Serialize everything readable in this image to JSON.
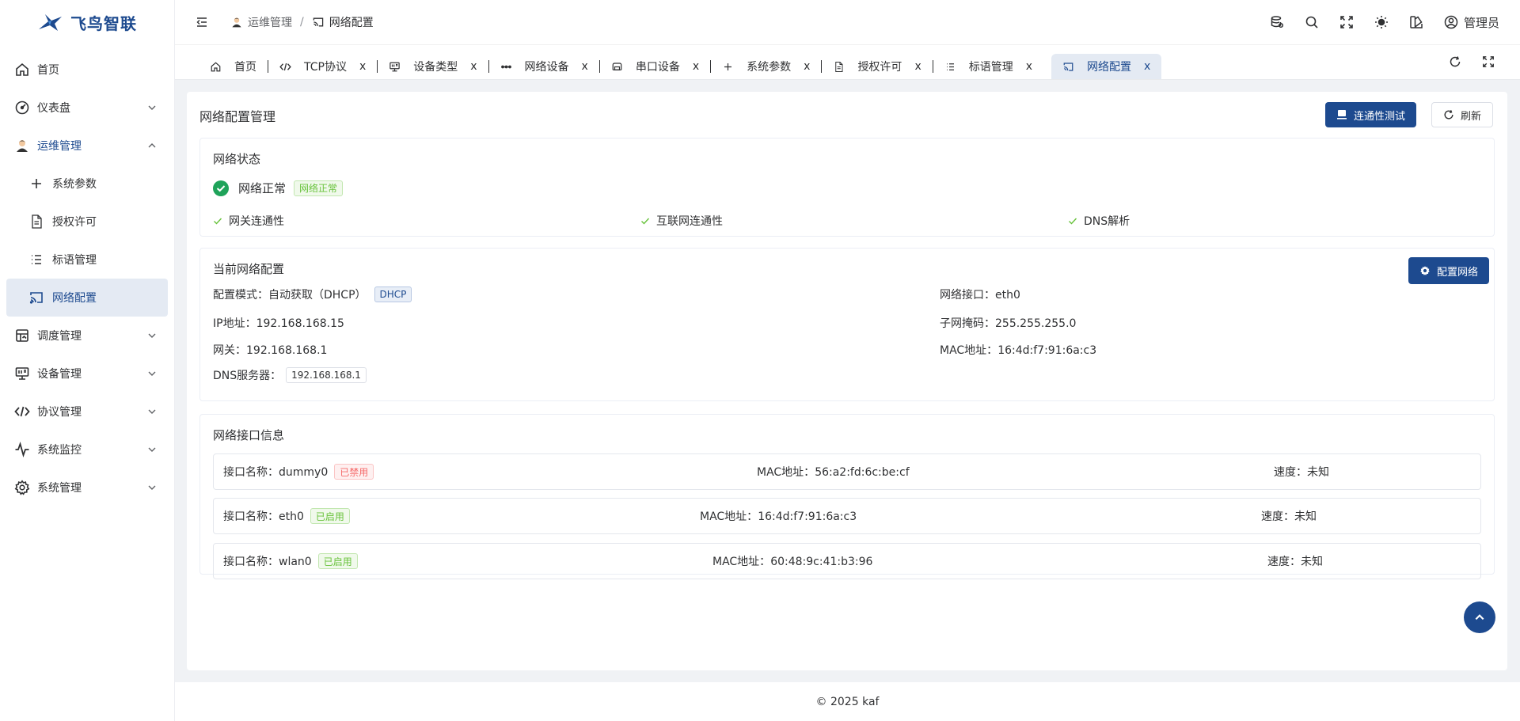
{
  "app": {
    "logo_text": "飞鸟智联"
  },
  "sidebar": {
    "items": [
      {
        "label": "首页",
        "icon": "home-icon"
      },
      {
        "label": "仪表盘",
        "icon": "dashboard-icon"
      },
      {
        "label": "运维管理",
        "icon": "user-avatar-icon"
      },
      {
        "label": "调度管理",
        "icon": "schedule-icon"
      },
      {
        "label": "设备管理",
        "icon": "device-icon"
      },
      {
        "label": "协议管理",
        "icon": "code-icon"
      },
      {
        "label": "系统监控",
        "icon": "pulse-icon"
      },
      {
        "label": "系统管理",
        "icon": "gear-icon"
      }
    ],
    "ops_children": [
      {
        "label": "系统参数",
        "icon": "plus-icon"
      },
      {
        "label": "授权许可",
        "icon": "document-icon"
      },
      {
        "label": "标语管理",
        "icon": "list-icon"
      },
      {
        "label": "网络配置",
        "icon": "cast-icon"
      }
    ]
  },
  "header": {
    "breadcrumb": [
      "运维管理",
      "网络配置"
    ],
    "breadcrumb_sep": "/",
    "user": "管理员"
  },
  "tabs": [
    {
      "label": "首页"
    },
    {
      "label": "TCP协议"
    },
    {
      "label": "设备类型"
    },
    {
      "label": "网络设备"
    },
    {
      "label": "串口设备"
    },
    {
      "label": "系统参数"
    },
    {
      "label": "授权许可"
    },
    {
      "label": "标语管理"
    },
    {
      "label": "网络配置"
    }
  ],
  "tab_close": "x",
  "main": {
    "title": "网络配置管理",
    "btn_test": "连通性测试",
    "btn_refresh": "刷新",
    "status": {
      "title": "网络状态",
      "text": "网络正常",
      "tag": "网络正常",
      "checks": [
        "网关连通性",
        "互联网连通性",
        "DNS解析"
      ]
    },
    "config": {
      "title": "当前网络配置",
      "btn_config": "配置网络",
      "mode_label": "配置模式：",
      "mode_value": "自动获取（DHCP）",
      "mode_tag": "DHCP",
      "ip_label": "IP地址：",
      "ip_value": "192.168.168.15",
      "gw_label": "网关：",
      "gw_value": "192.168.168.1",
      "dns_label": "DNS服务器：",
      "dns_value": "192.168.168.1",
      "iface_label": "网络接口：",
      "iface_value": "eth0",
      "mask_label": "子网掩码：",
      "mask_value": "255.255.255.0",
      "mac_label": "MAC地址：",
      "mac_value": "16:4d:f7:91:6a:c3"
    },
    "interfaces": {
      "title": "网络接口信息",
      "name_label": "接口名称：",
      "mac_label": "MAC地址：",
      "speed_label": "速度：",
      "rows": [
        {
          "name": "dummy0",
          "status": "已禁用",
          "mac": "56:a2:fd:6c:be:cf",
          "speed": "未知"
        },
        {
          "name": "eth0",
          "status": "已启用",
          "mac": "16:4d:f7:91:6a:c3",
          "speed": "未知"
        },
        {
          "name": "wlan0",
          "status": "已启用",
          "mac": "60:48:9c:41:b3:96",
          "speed": "未知"
        }
      ]
    }
  },
  "footer": {
    "text": "© 2025 kaf"
  },
  "colors": {
    "primary": "#1d4a8f",
    "success": "#67c23a",
    "danger": "#f56c6c"
  }
}
